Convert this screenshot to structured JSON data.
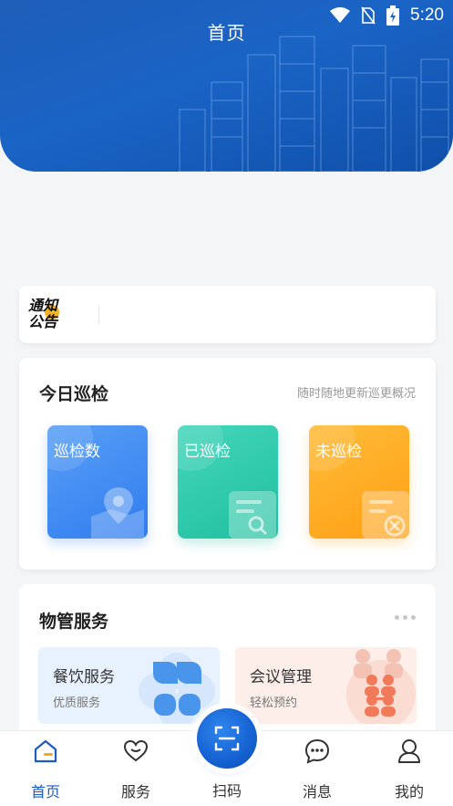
{
  "status_bar": {
    "time": "5:20",
    "icons": [
      "wifi-icon",
      "no-sim-icon",
      "battery-charging-icon"
    ]
  },
  "header": {
    "title": "首页",
    "background_color": "#1a64c6"
  },
  "notice": {
    "logo_line1": "通知",
    "logo_line2": "公告",
    "logo_accent": "#f5b323"
  },
  "patrol": {
    "title": "今日巡检",
    "subtitle": "随时随地更新巡更概况",
    "tiles": [
      {
        "label": "巡检数",
        "icon": "map-pin-icon",
        "color": "#2f7cef"
      },
      {
        "label": "已巡检",
        "icon": "document-search-icon",
        "color": "#1fbf9f"
      },
      {
        "label": "未巡检",
        "icon": "document-cancel-icon",
        "color": "#ff9f13"
      }
    ]
  },
  "services": {
    "title": "物管服务",
    "more_icon": "more-dots-icon",
    "items": [
      {
        "title": "餐饮服务",
        "subtitle": "优质服务",
        "icon": "clover-icon",
        "color": "#4a95ec"
      },
      {
        "title": "会议管理",
        "subtitle": "轻松预约",
        "icon": "meeting-people-icon",
        "color": "#f07a5a"
      }
    ]
  },
  "bottom_nav": {
    "items": [
      {
        "label": "首页",
        "icon": "home-icon",
        "active": true
      },
      {
        "label": "服务",
        "icon": "heart-icon",
        "active": false
      },
      {
        "label": "扫码",
        "icon": "scan-icon",
        "active": false
      },
      {
        "label": "消息",
        "icon": "chat-bubble-icon",
        "active": false
      },
      {
        "label": "我的",
        "icon": "user-icon",
        "active": false
      }
    ],
    "active_color": "#1a5cc0"
  }
}
